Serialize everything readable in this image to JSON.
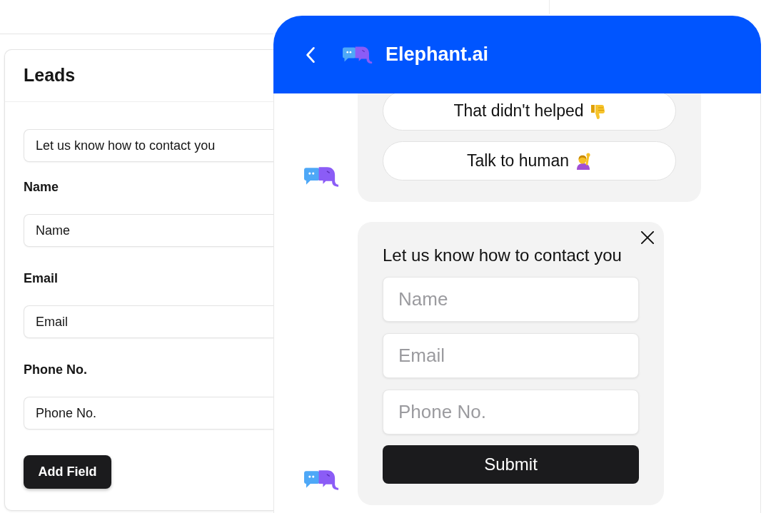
{
  "leads_panel": {
    "title": "Leads",
    "fields": [
      {
        "value": "Let us know how to contact you"
      },
      {
        "label": "Name",
        "value": "Name"
      },
      {
        "label": "Email",
        "value": "Email"
      },
      {
        "label": "Phone No.",
        "value": "Phone No."
      }
    ],
    "add_button": "Add Field"
  },
  "chat_window": {
    "title": "Elephant.ai",
    "messages": [
      {
        "kind": "options",
        "options": [
          {
            "kind": "negative_feedback",
            "label": "That didn't helped"
          },
          {
            "kind": "human_handoff",
            "label": "Talk to human"
          }
        ]
      },
      {
        "kind": "contact_form",
        "title": "Let us know how to contact you",
        "fields": [
          {
            "placeholder": "Name"
          },
          {
            "placeholder": "Email"
          },
          {
            "placeholder": "Phone No."
          }
        ],
        "submit": "Submit"
      }
    ]
  }
}
